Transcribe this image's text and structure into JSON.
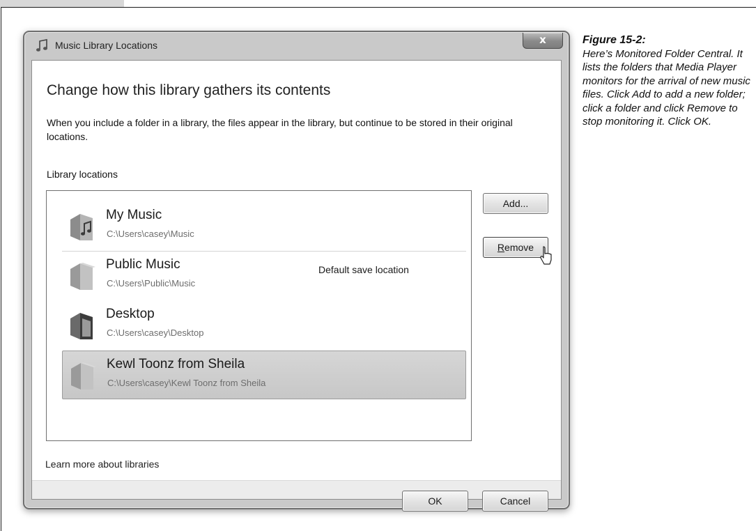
{
  "window": {
    "title": "Music Library Locations",
    "close_label": "x"
  },
  "dialog": {
    "heading": "Change how this library gathers its contents",
    "description": "When you include a folder in a library, the files appear in the library, but continue to be stored in their original locations.",
    "locations_label": "Library locations",
    "learn_more": "Learn more about libraries"
  },
  "locations": [
    {
      "name": "My Music",
      "path": "C:\\Users\\casey\\Music",
      "note": "",
      "icon": "music-folder-icon",
      "selected": false
    },
    {
      "name": "Public Music",
      "path": "C:\\Users\\Public\\Music",
      "note": "Default save location",
      "icon": "folder-icon",
      "selected": false
    },
    {
      "name": "Desktop",
      "path": "C:\\Users\\casey\\Desktop",
      "note": "",
      "icon": "desktop-folder-icon",
      "selected": false
    },
    {
      "name": "Kewl Toonz from Sheila",
      "path": "C:\\Users\\casey\\Kewl Toonz from Sheila",
      "note": "",
      "icon": "folder-icon",
      "selected": true
    }
  ],
  "buttons": {
    "add": "Add...",
    "remove_underlined": "R",
    "remove_rest": "emove",
    "ok": "OK",
    "cancel": "Cancel"
  },
  "caption": {
    "title": "Figure 15-2:",
    "text": "Here’s Monitored Folder Central. It lists the folders that Media Player monitors for the arrival of new music files. Click Add to add a new folder; click a folder and click Remove to stop monitoring it. Click OK."
  },
  "colors": {
    "window_frame": "#c9c9c9",
    "selection": "#cfcfcf",
    "footer": "#ececec"
  }
}
